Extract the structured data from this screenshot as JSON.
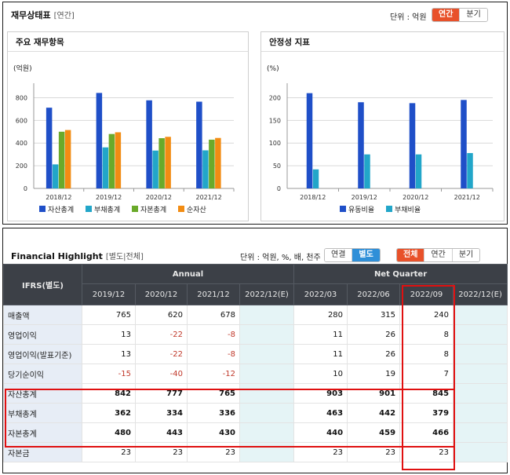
{
  "top": {
    "title": "재무상태표",
    "subtitle": "[연간]",
    "unit": "단위 : 억원",
    "toggle": [
      "연간",
      "분기"
    ],
    "active": 0
  },
  "panel_left_title": "주요 재무항목",
  "panel_right_title": "안정성 지표",
  "colors": {
    "series1": "#1f4fc8",
    "series2": "#22a6c9",
    "series3": "#6aaa2a",
    "series4": "#f28c13",
    "accent_orange": "#e8512a",
    "accent_blue": "#2f8fd8",
    "highlight": "#e01010",
    "negative": "#c0392b"
  },
  "chart_data": [
    {
      "type": "bar",
      "ylabel": "(억원)",
      "categories": [
        "2018/12",
        "2019/12",
        "2020/12",
        "2021/12"
      ],
      "ylim": [
        0,
        900
      ],
      "yticks": [
        0,
        200,
        400,
        600,
        800
      ],
      "legend": "bottom",
      "series": [
        {
          "name": "자산총계",
          "values": [
            712,
            842,
            777,
            765
          ]
        },
        {
          "name": "부채총계",
          "values": [
            212,
            362,
            334,
            336
          ]
        },
        {
          "name": "자본총계",
          "values": [
            500,
            480,
            443,
            430
          ]
        },
        {
          "name": "순자산",
          "values": [
            515,
            495,
            455,
            445
          ]
        }
      ]
    },
    {
      "type": "bar",
      "ylabel": "(%)",
      "categories": [
        "2018/12",
        "2019/12",
        "2020/12",
        "2021/12"
      ],
      "ylim": [
        0,
        225
      ],
      "yticks": [
        0,
        50,
        100,
        150,
        200
      ],
      "legend": "bottom",
      "series": [
        {
          "name": "유동비율",
          "values": [
            210,
            190,
            188,
            195
          ]
        },
        {
          "name": "부채비율",
          "values": [
            42,
            75,
            75,
            78
          ]
        }
      ]
    }
  ],
  "fh": {
    "title": "Financial Highlight",
    "subtitle": "[별도|전체]",
    "unit": "단위 : 억원, %, 배, 천주",
    "toggle1": [
      "연결",
      "별도"
    ],
    "toggle1_active": 1,
    "toggle2": [
      "전체",
      "연간",
      "분기"
    ],
    "toggle2_active": 0,
    "ifrs_label": "IFRS(별도)",
    "group_annual": "Annual",
    "group_quarter": "Net Quarter",
    "periods": [
      "2019/12",
      "2020/12",
      "2021/12",
      "2022/12(E)",
      "2022/03",
      "2022/06",
      "2022/09",
      "2022/12(E)"
    ],
    "rows": [
      {
        "label": "매출액",
        "values": [
          "765",
          "620",
          "678",
          "",
          "280",
          "315",
          "240",
          ""
        ],
        "bold": false
      },
      {
        "label": "영업이익",
        "values": [
          "13",
          "-22",
          "-8",
          "",
          "11",
          "26",
          "8",
          ""
        ],
        "bold": false
      },
      {
        "label": "영업이익(발표기준)",
        "values": [
          "13",
          "-22",
          "-8",
          "",
          "11",
          "26",
          "8",
          ""
        ],
        "bold": false
      },
      {
        "label": "당기순이익",
        "values": [
          "-15",
          "-40",
          "-12",
          "",
          "10",
          "19",
          "7",
          ""
        ],
        "bold": false
      },
      {
        "label": "자산총계",
        "values": [
          "842",
          "777",
          "765",
          "",
          "903",
          "901",
          "845",
          ""
        ],
        "bold": true
      },
      {
        "label": "부채총계",
        "values": [
          "362",
          "334",
          "336",
          "",
          "463",
          "442",
          "379",
          ""
        ],
        "bold": true
      },
      {
        "label": "자본총계",
        "values": [
          "480",
          "443",
          "430",
          "",
          "440",
          "459",
          "466",
          ""
        ],
        "bold": true
      },
      {
        "label": "자본금",
        "values": [
          "23",
          "23",
          "23",
          "",
          "23",
          "23",
          "23",
          ""
        ],
        "bold": false
      }
    ]
  }
}
